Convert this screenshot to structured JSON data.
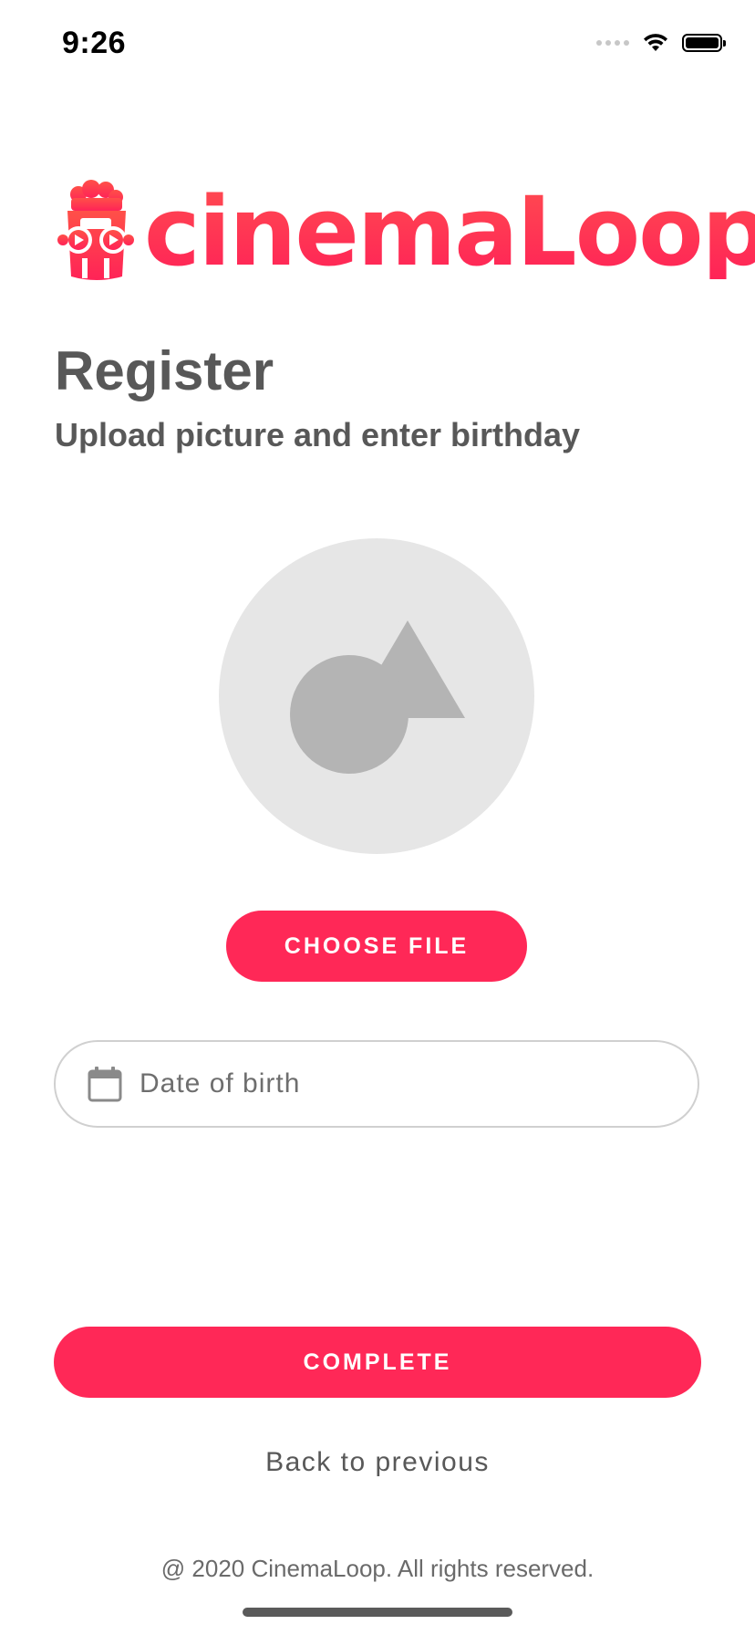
{
  "status_bar": {
    "time": "9:26"
  },
  "logo": {
    "wordmark": "cinemaLoop",
    "brand_color": "#ff2857"
  },
  "header": {
    "title": "Register",
    "subtitle": "Upload picture and enter birthday"
  },
  "avatar": {
    "icon": "image-placeholder-icon"
  },
  "upload": {
    "choose_file_label": "CHOOSE FILE"
  },
  "form": {
    "dob_placeholder": "Date of birth",
    "dob_value": "",
    "dob_icon": "calendar-icon"
  },
  "actions": {
    "complete_label": "COMPLETE",
    "back_label": "Back to previous"
  },
  "footer": {
    "copyright": "@ 2020 CinemaLoop. All rights reserved."
  },
  "colors": {
    "accent": "#ff2857",
    "text": "#585858",
    "avatar_bg": "#e6e6e6",
    "avatar_shape": "#b4b4b4"
  }
}
